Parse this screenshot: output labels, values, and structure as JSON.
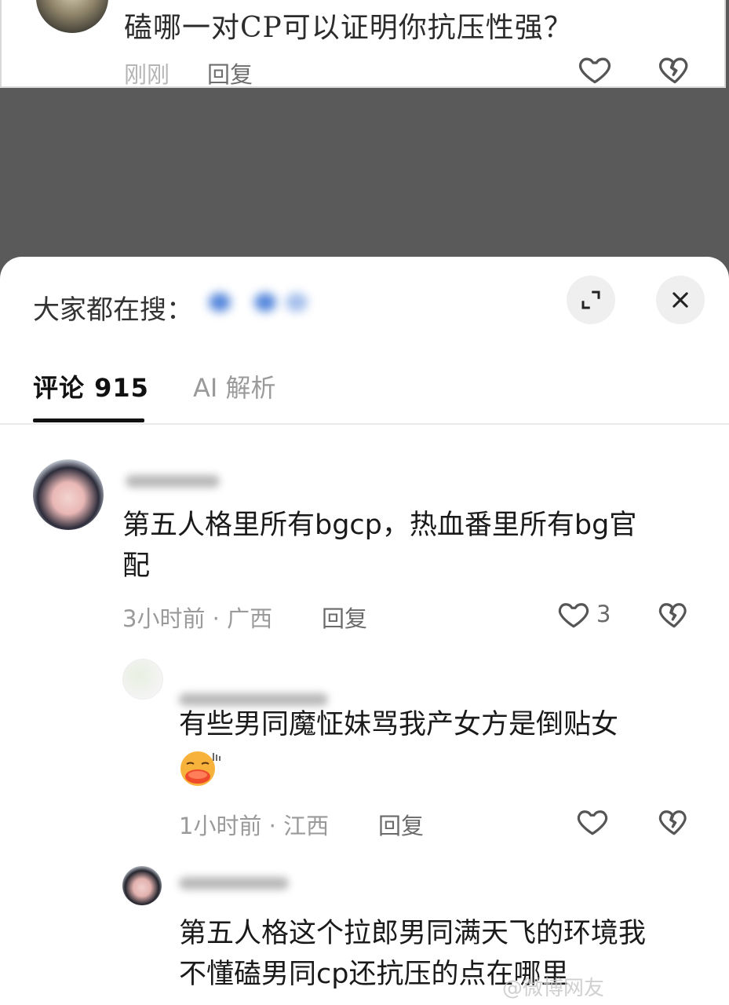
{
  "top_post": {
    "question": "磕哪一对CP可以证明你抗压性强？",
    "time": "刚刚",
    "reply": "回复"
  },
  "sheet": {
    "search_label": "大家都在搜：",
    "tabs": [
      {
        "label": "评论 915",
        "active": true
      },
      {
        "label": "AI 解析",
        "active": false
      }
    ]
  },
  "comments": [
    {
      "text_line1": "第五人格里所有bgcp，热血番里所有bg官",
      "text_line2": "配",
      "meta": "3小时前 · 广西",
      "reply": "回复",
      "likes": "3"
    },
    {
      "text": "有些男同魔怔妹骂我产女方是倒贴女",
      "meta": "1小时前 · 江西",
      "reply": "回复"
    },
    {
      "text_line1": "第五人格这个拉郎男同满天飞的环境我",
      "text_line2": "不懂磕男同cp还抗压的点在哪里"
    }
  ],
  "watermark": "@微博网友"
}
